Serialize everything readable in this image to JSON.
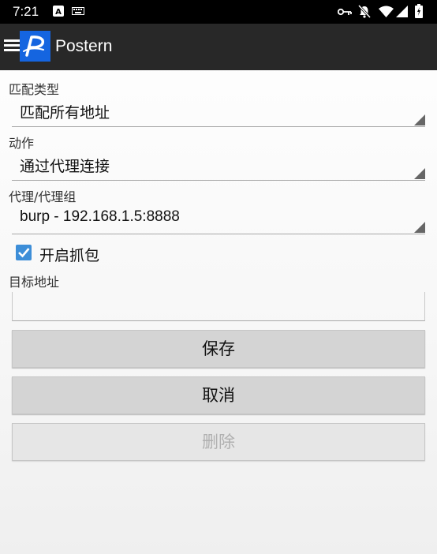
{
  "status_bar": {
    "time": "7:21",
    "left_icons": [
      "a-badge-icon",
      "keyboard-icon"
    ],
    "right_icons": [
      "key-icon",
      "notifications-off-icon",
      "wifi-icon",
      "signal-icon",
      "battery-icon"
    ]
  },
  "app_bar": {
    "title": "Postern",
    "logo_letter": "P",
    "logo_color": "#1565e0"
  },
  "form": {
    "match_type": {
      "label": "匹配类型",
      "value": "匹配所有地址"
    },
    "action": {
      "label": "动作",
      "value": "通过代理连接"
    },
    "proxy": {
      "label": "代理/代理组",
      "value": "burp - 192.168.1.5:8888"
    },
    "capture": {
      "label": "开启抓包",
      "checked": true
    },
    "target": {
      "label": "目标地址",
      "value": ""
    }
  },
  "buttons": {
    "save": "保存",
    "cancel": "取消",
    "delete": "删除"
  },
  "colors": {
    "accent": "#3d8ed8",
    "app_bar": "#282828"
  }
}
